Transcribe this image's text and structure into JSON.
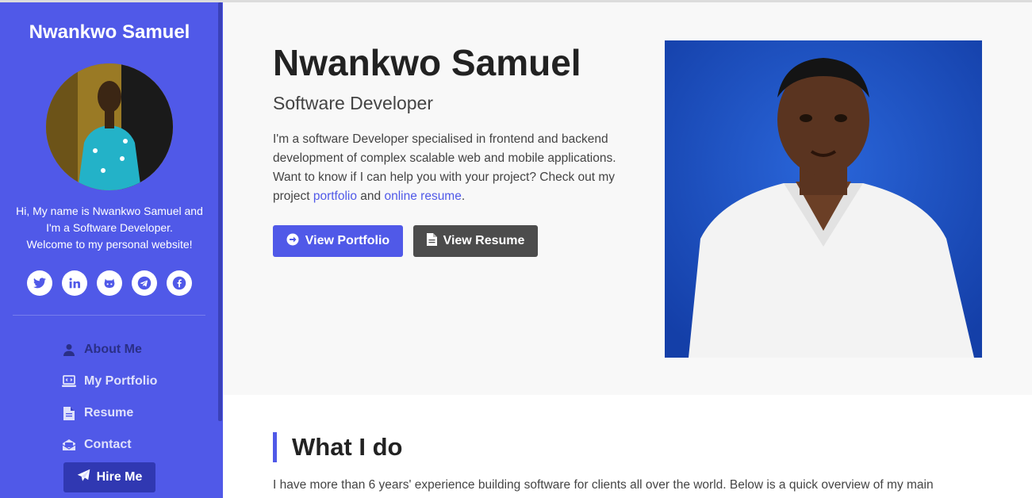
{
  "sidebar": {
    "title": "Nwankwo Samuel",
    "bio_line1": "Hi, My name is Nwankwo Samuel and",
    "bio_line2": "I'm a Software Developer.",
    "bio_line3": "Welcome to my personal website!",
    "social": [
      "twitter-icon",
      "linkedin-icon",
      "github-icon",
      "telegram-icon",
      "facebook-icon"
    ],
    "nav": [
      {
        "label": "About Me",
        "icon": "user-icon",
        "active": true
      },
      {
        "label": "My Portfolio",
        "icon": "laptop-code-icon"
      },
      {
        "label": "Resume",
        "icon": "file-icon"
      },
      {
        "label": "Contact",
        "icon": "envelope-icon"
      }
    ],
    "hire_label": "Hire Me"
  },
  "hero": {
    "name": "Nwankwo Samuel",
    "role": "Software Developer",
    "desc_part1": "I'm a software Developer specialised in frontend and backend development of complex scalable web and mobile applications. Want to know if I can help you with your project? Check out my project ",
    "link_portfolio": "portfolio",
    "desc_and": " and ",
    "link_resume": "online resume",
    "desc_end": ".",
    "btn_portfolio": "View Portfolio",
    "btn_resume": "View Resume"
  },
  "section": {
    "title": "What I do",
    "text": "I have more than 6 years' experience building software for clients all over the world. Below is a quick overview of my main"
  },
  "colors": {
    "accent": "#5059e8",
    "dark_button": "#4c4c4c",
    "hero_bg": "#f8f8f8"
  }
}
